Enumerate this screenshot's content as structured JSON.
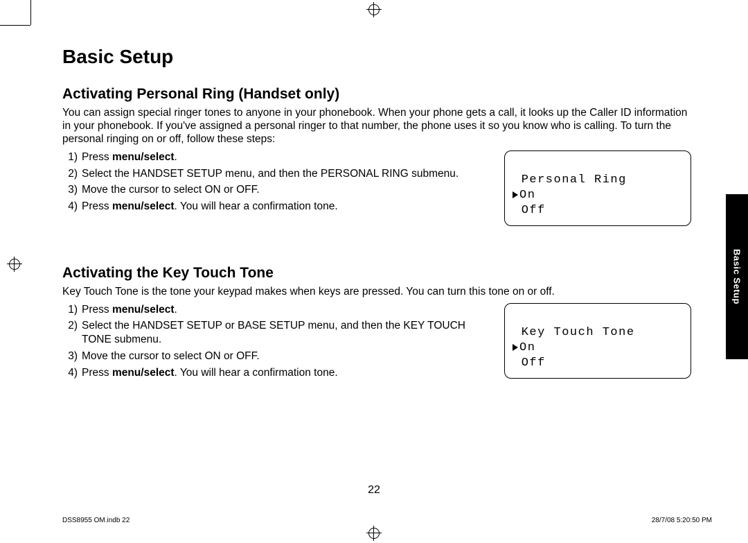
{
  "page_title": "Basic Setup",
  "side_tab": "Basic Setup",
  "page_number": "22",
  "footer_left": "DSS8955 OM.indb   22",
  "footer_right": "28/7/08   5:20:50 PM",
  "section1": {
    "heading": "Activating Personal Ring (Handset only)",
    "intro": "You can assign special ringer tones to anyone in your phonebook. When your phone gets a call, it looks up the Caller ID information in your phonebook. If you've assigned a personal ringer to that number, the phone uses it so you know who is calling. To turn the personal ringing on or off, follow these steps:",
    "steps": {
      "s1a": "Press ",
      "s1b": "menu/select",
      "s1c": ".",
      "s2": "Select the HANDSET SETUP menu, and then the PERSONAL RING submenu.",
      "s3": "Move the cursor to select ON or OFF.",
      "s4a": "Press ",
      "s4b": "menu/select",
      "s4c": ". You will hear a confirmation tone."
    },
    "lcd": {
      "title": " Personal Ring",
      "on": "On",
      "off": " Off"
    }
  },
  "section2": {
    "heading": "Activating the Key Touch Tone",
    "intro": "Key Touch Tone is the tone your keypad makes when keys are pressed. You can turn this tone on or off.",
    "steps": {
      "s1a": "Press ",
      "s1b": "menu/select",
      "s1c": ".",
      "s2": "Select the HANDSET SETUP or BASE SETUP menu, and then the KEY TOUCH TONE submenu.",
      "s3": "Move the cursor to select ON or OFF.",
      "s4a": "Press ",
      "s4b": "menu/select",
      "s4c": ". You will hear a confirmation tone."
    },
    "lcd": {
      "title": " Key Touch Tone",
      "on": "On",
      "off": " Off"
    }
  }
}
